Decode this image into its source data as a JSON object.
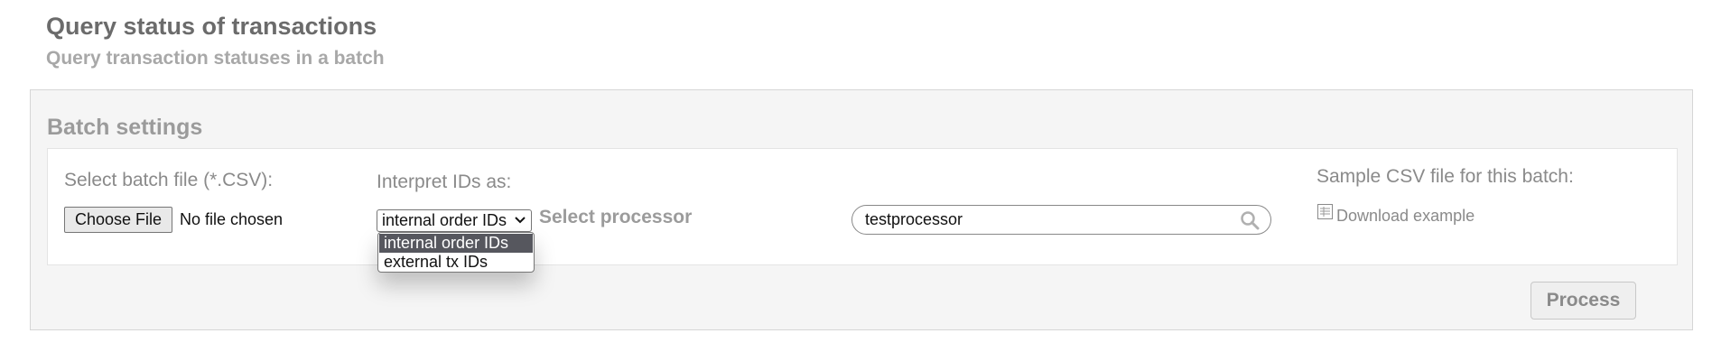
{
  "page": {
    "title": "Query status of transactions",
    "subtitle": "Query transaction statuses in a batch"
  },
  "batch_settings": {
    "title": "Batch settings",
    "file": {
      "label": "Select batch file (*.CSV):",
      "button_label": "Choose File",
      "status": "No file chosen"
    },
    "interpret": {
      "label": "Interpret IDs as:",
      "selected": "internal order IDs",
      "options": [
        "internal order IDs",
        "external tx IDs"
      ],
      "highlighted_index": 0
    },
    "processor": {
      "label": "Select processor",
      "value": "testprocessor",
      "icon": "search-icon"
    },
    "sample": {
      "label": "Sample CSV file for this batch:",
      "link_label": "Download example",
      "icon": "csv-file-icon"
    },
    "process_button": "Process"
  },
  "colors": {
    "title": "#6b6b6b",
    "muted": "#a8a8a8",
    "panel_bg": "#f5f5f5",
    "highlight": "#56575e"
  }
}
